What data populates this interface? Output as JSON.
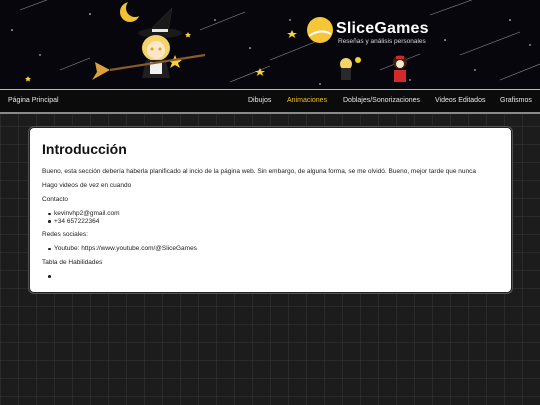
{
  "header": {
    "brand_name": "SliceGames",
    "tagline": "Reseñas y análisis personales",
    "colors": {
      "background": "#06060c",
      "accent": "#f0c020"
    }
  },
  "nav": {
    "home": "Página Principal",
    "items": [
      "Dibujos",
      "Animaciones",
      "Doblajes/Sonorizaciones",
      "Videos Editados",
      "Grafismos"
    ],
    "active": "Animaciones"
  },
  "content": {
    "title": "Introducción",
    "intro": "Bueno, esta sección debería haberla planificado al incio de la página web. Sin embargo, de alguna forma, se me olvidó. Bueno, mejor tarde que nunca",
    "videos_note": "Hago videos de vez en cuando",
    "contact_heading": "Contacto",
    "contact": [
      "kevinvhp2@gmail.com",
      "+34 657222364"
    ],
    "social_heading": "Redes sociales:",
    "social": [
      "Youtube: https://www.youtube.com/@SliceGames"
    ],
    "skills_heading": "Tabla de Habilidades",
    "skills": [
      ""
    ]
  }
}
